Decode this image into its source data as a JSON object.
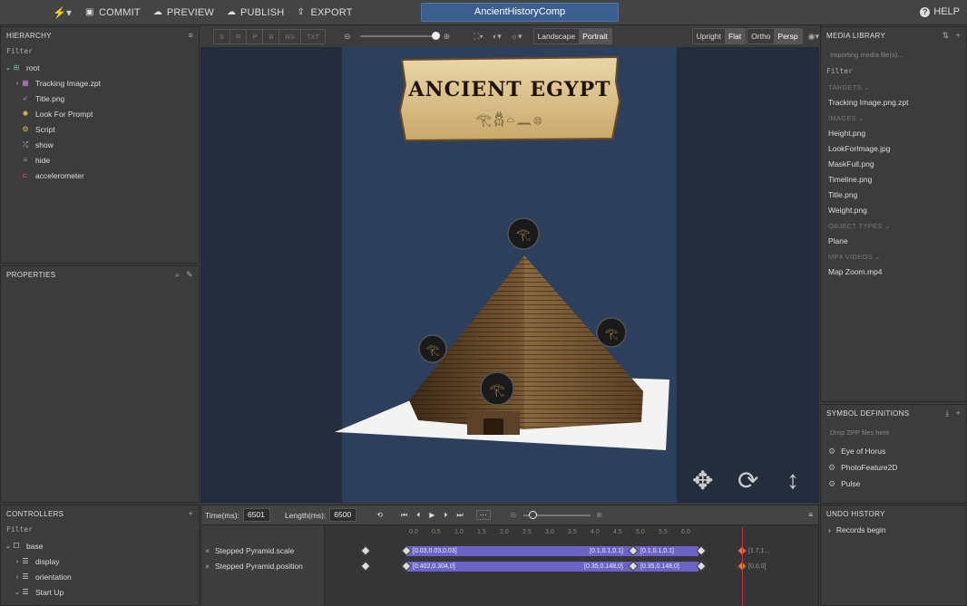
{
  "topbar": {
    "commit": "COMMIT",
    "preview": "PREVIEW",
    "publish": "PUBLISH",
    "export": "EXPORT",
    "comp_title": "AncientHistoryComp",
    "help": "HELP"
  },
  "hierarchy": {
    "title": "HIERARCHY",
    "filter": "Filter",
    "items": [
      {
        "label": "root"
      },
      {
        "label": "Tracking Image.zpt"
      },
      {
        "label": "Title.png"
      },
      {
        "label": "Look For Prompt"
      },
      {
        "label": "Script"
      },
      {
        "label": "show"
      },
      {
        "label": "hide"
      },
      {
        "label": "accelerometer"
      }
    ]
  },
  "properties": {
    "title": "PROPERTIES"
  },
  "controllers": {
    "title": "CONTROLLERS",
    "filter": "Filter",
    "items": [
      {
        "label": "base"
      },
      {
        "label": "display"
      },
      {
        "label": "orientation"
      },
      {
        "label": "Start Up"
      }
    ]
  },
  "viewport_toolbar": {
    "transform_modes": [
      "S",
      "R",
      "P",
      "B",
      "RS",
      "TXT"
    ],
    "landscape": "Landscape",
    "portrait": "Portrait",
    "upright": "Upright",
    "flat": "Flat",
    "ortho": "Ortho",
    "persp": "Persp"
  },
  "scene": {
    "sign_title": "ANCIENT EGYPT",
    "sign_subtitle": "𓂀𓆣𓏏𓈖𓊖"
  },
  "media_library": {
    "title": "MEDIA LIBRARY",
    "importing": "Importing media file(s)...",
    "filter": "Filter",
    "sections": [
      {
        "name": "TARGETS",
        "items": [
          "Tracking Image.png.zpt"
        ]
      },
      {
        "name": "IMAGES",
        "items": [
          "Height.png",
          "LookForImage.jpg",
          "MaskFull.png",
          "Timeline.png",
          "Title.png",
          "Weight.png"
        ]
      },
      {
        "name": "OBJECT TYPES",
        "items": [
          "Plane"
        ]
      },
      {
        "name": "MP4 VIDEOS",
        "items": [
          "Map Zoom.mp4"
        ]
      }
    ]
  },
  "symbols": {
    "title": "SYMBOL DEFINITIONS",
    "drop_hint": "Drop ZPP files here",
    "items": [
      "Eye of Horus",
      "PhotoFeature2D",
      "Pulse"
    ]
  },
  "undo": {
    "title": "UNDO HISTORY",
    "items": [
      "Records begin"
    ]
  },
  "timeline": {
    "time_label": "Time(ms):",
    "time_value": "6501",
    "length_label": "Length(ms):",
    "length_value": "6500",
    "ticks": [
      "0.0",
      "0.5",
      "1.0",
      "1.5",
      "2.0",
      "2.5",
      "3.0",
      "3.5",
      "4.0",
      "4.5",
      "5.0",
      "5.5",
      "6.0"
    ],
    "tracks": [
      {
        "label": "Stepped Pyramid.scale",
        "v1": "[0.03,0.03,0.03]",
        "v2": "[0.1,0.1,0.1]",
        "v3": "[0.1,0.1,0.1]",
        "v4": "[1.7,1..."
      },
      {
        "label": "Stepped Pyramid.position",
        "v1": "[0.402,0.304,0]",
        "v2": "[0.35,0.148,0]",
        "v3": "[0.35,0.148,0]",
        "v4": "[0,0,0]"
      }
    ]
  }
}
